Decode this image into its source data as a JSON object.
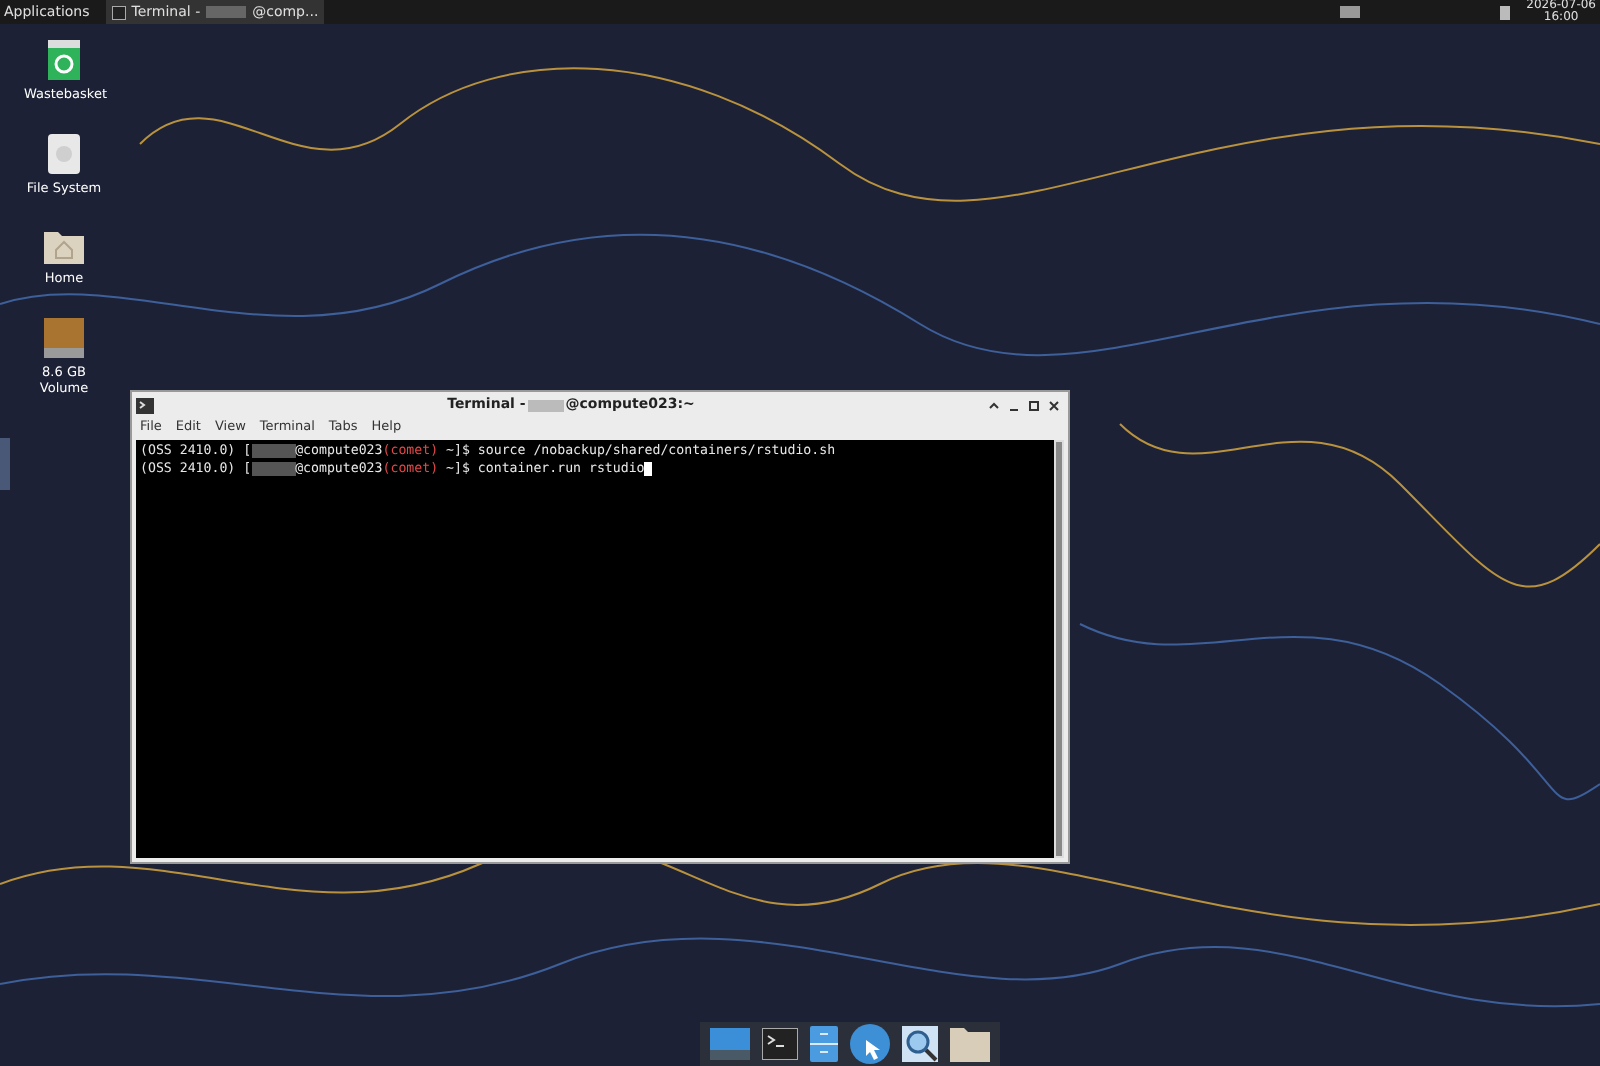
{
  "top_panel": {
    "applications": "Applications",
    "task_prefix": "Terminal - ",
    "task_suffix": "@comp...",
    "date": "2026-07-06",
    "time": "16:00"
  },
  "desktop_icons": [
    {
      "kind": "trash",
      "label": "Wastebasket"
    },
    {
      "kind": "drive",
      "label": "File System"
    },
    {
      "kind": "home",
      "label": "Home"
    },
    {
      "kind": "volume",
      "label": "8.6 GB Volume"
    }
  ],
  "terminal": {
    "title_prefix": "Terminal - ",
    "title_suffix": "@compute023:~",
    "menu": [
      "File",
      "Edit",
      "View",
      "Terminal",
      "Tabs",
      "Help"
    ],
    "lines": [
      {
        "prefix": "(OSS 2410.0) [",
        "host": "@compute023",
        "env": "(comet)",
        "prompt": " ~]$ ",
        "command": "source /nobackup/shared/containers/rstudio.sh",
        "cursor": false
      },
      {
        "prefix": "(OSS 2410.0) [",
        "host": "@compute023",
        "env": "(comet)",
        "prompt": " ~]$ ",
        "command": "container.run rstudio",
        "cursor": true
      }
    ]
  },
  "dock": [
    {
      "kind": "desktop"
    },
    {
      "kind": "terminal"
    },
    {
      "kind": "cabinet"
    },
    {
      "kind": "browser"
    },
    {
      "kind": "search"
    },
    {
      "kind": "folder"
    }
  ]
}
